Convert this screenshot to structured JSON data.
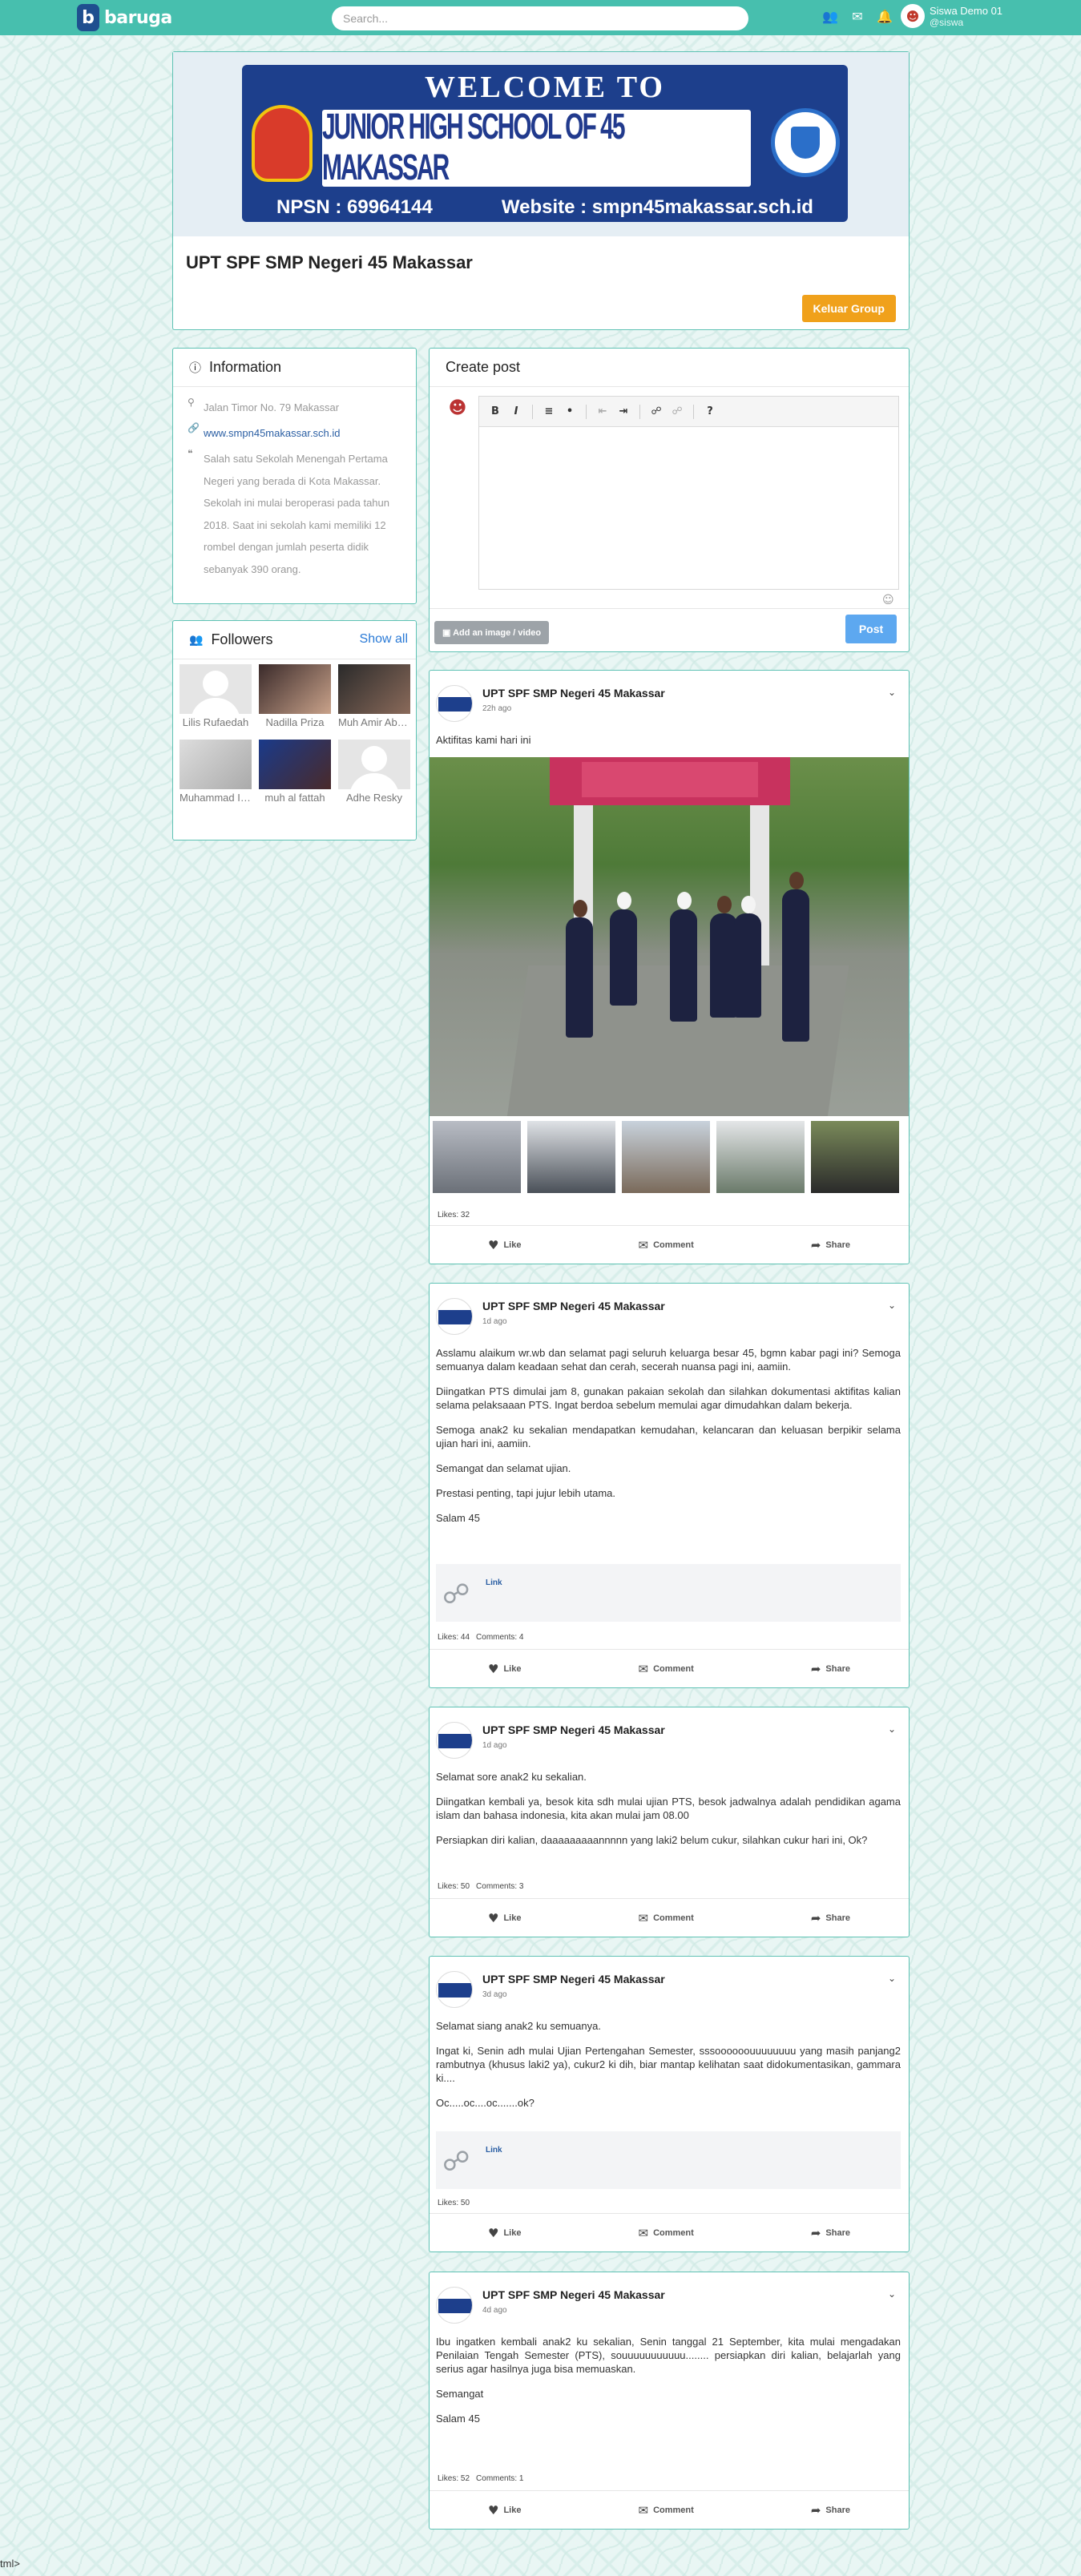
{
  "topbar": {
    "logo_text": "baruga",
    "logo_mark": "b",
    "search_placeholder": "Search...",
    "icons": [
      "users-icon",
      "mail-icon",
      "bell-icon"
    ],
    "user_name": "Siswa Demo 01",
    "user_handle": "@siswa"
  },
  "group": {
    "banner_top": "WELCOME  TO",
    "banner_middle": "JUNIOR HIGH SCHOOL OF 45 MAKASSAR",
    "banner_npsn": "NPSN : 69964144",
    "banner_website": "Website : smpn45makassar.sch.id",
    "name": "UPT SPF SMP Negeri 45 Makassar",
    "leave_button": "Keluar Group"
  },
  "information": {
    "title": "Information",
    "address": "Jalan Timor No. 79 Makassar",
    "website": "www.smpn45makassar.sch.id",
    "description": "Salah satu Sekolah Menengah Pertama Negeri yang berada di Kota Makassar. Sekolah ini mulai beroperasi pada tahun 2018. Saat ini sekolah kami memiliki 12 rombel dengan jumlah peserta didik sebanyak 390 orang."
  },
  "followers": {
    "title": "Followers",
    "show_all": "Show all",
    "items": [
      {
        "name": "Lilis Rufaedah",
        "photo": "placeholder"
      },
      {
        "name": "Nadilla Priza",
        "photo": "photo"
      },
      {
        "name": "Muh Amir Abbas",
        "photo": "photo"
      },
      {
        "name": "Muhammad Ibnu",
        "photo": "photo"
      },
      {
        "name": "muh al fattah",
        "photo": "photo"
      },
      {
        "name": "Adhe Resky",
        "photo": "placeholder"
      }
    ]
  },
  "create_post": {
    "title": "Create post",
    "add_media": "Add an image / video",
    "post_button": "Post"
  },
  "actions": {
    "like": "Like",
    "comment": "Comment",
    "share": "Share",
    "link": "Link"
  },
  "posts": [
    {
      "author": "UPT SPF SMP Negeri 45 Makassar",
      "time": "22h ago",
      "paragraphs": [
        "Aktifitas kami hari ini"
      ],
      "likes": "Likes: 32",
      "comments": ""
    },
    {
      "author": "UPT SPF SMP Negeri 45 Makassar",
      "time": "1d ago",
      "paragraphs": [
        "Asslamu alaikum wr.wb dan selamat pagi seluruh keluarga besar 45, bgmn kabar pagi ini? Semoga semuanya dalam keadaan sehat dan cerah, secerah nuansa pagi ini, aamiin.",
        "Diingatkan PTS dimulai jam 8, gunakan pakaian sekolah dan silahkan dokumentasi aktifitas kalian selama pelaksaaan PTS. Ingat berdoa sebelum memulai agar dimudahkan dalam bekerja.",
        "Semoga anak2 ku sekalian mendapatkan kemudahan, kelancaran dan keluasan berpikir selama ujian hari ini, aamiin.",
        "Semangat dan selamat ujian.",
        "Prestasi penting, tapi jujur  lebih utama.",
        "Salam 45"
      ],
      "likes": "Likes: 44",
      "comments": "Comments: 4"
    },
    {
      "author": "UPT SPF SMP Negeri 45 Makassar",
      "time": "1d ago",
      "paragraphs": [
        "Selamat sore anak2 ku sekalian.",
        "Diingatkan kembali ya, besok kita sdh mulai ujian PTS, besok jadwalnya adalah pendidikan agama islam dan bahasa indonesia, kita akan mulai jam 08.00",
        "Persiapkan diri kalian, daaaaaaaaannnnn yang laki2 belum cukur, silahkan cukur hari ini, Ok?"
      ],
      "likes": "Likes: 50",
      "comments": "Comments: 3"
    },
    {
      "author": "UPT SPF SMP Negeri 45 Makassar",
      "time": "3d ago",
      "paragraphs": [
        "Selamat siang anak2 ku semuanya.",
        "Ingat ki, Senin adh mulai Ujian Pertengahan Semester, sssoooooouuuuuuuu yang masih panjang2 rambutnya (khusus laki2 ya), cukur2 ki dih, biar mantap kelihatan saat didokumentasikan, gammara ki....",
        "Oc.....oc....oc.......ok?"
      ],
      "likes": "Likes: 50",
      "comments": ""
    },
    {
      "author": "UPT SPF SMP Negeri 45 Makassar",
      "time": "4d ago",
      "paragraphs": [
        "Ibu ingatken kembali anak2 ku sekalian, Senin tanggal 21 September, kita mulai mengadakan Penilaian Tengah Semester (PTS), souuuuuuuuuuu........ persiapkan diri kalian, belajarlah yang serius agar hasilnya juga bisa memuaskan.",
        "Semangat",
        "Salam 45"
      ],
      "likes": "Likes: 52",
      "comments": "Comments: 1"
    }
  ],
  "footer_fragment": "tml>"
}
